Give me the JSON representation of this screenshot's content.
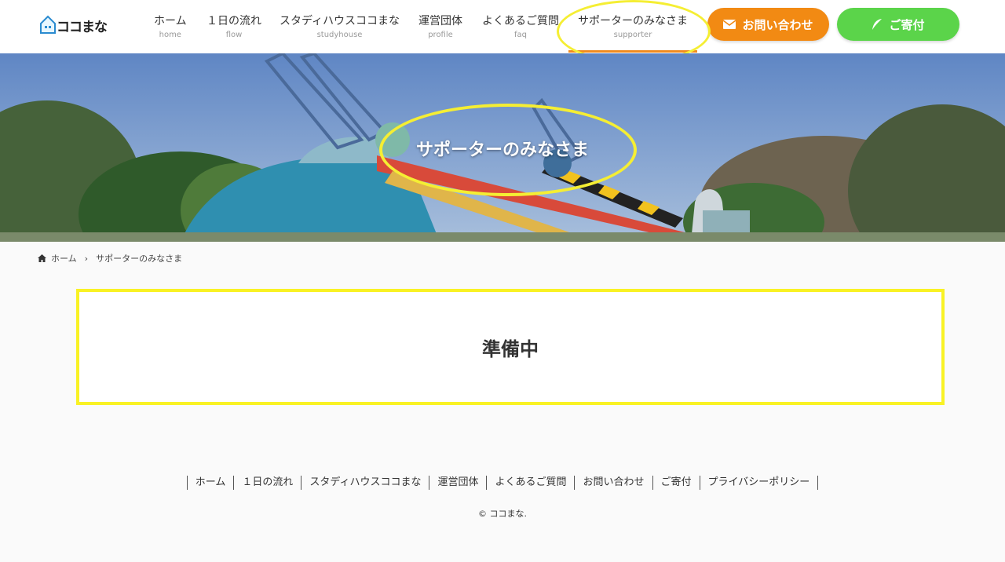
{
  "logo": {
    "text": "ココまな"
  },
  "nav": [
    {
      "label": "ホーム",
      "sub": "home",
      "active": false
    },
    {
      "label": "１日の流れ",
      "sub": "flow",
      "active": false
    },
    {
      "label": "スタディハウスココまな",
      "sub": "studyhouse",
      "active": false
    },
    {
      "label": "運営団体",
      "sub": "profile",
      "active": false
    },
    {
      "label": "よくあるご質問",
      "sub": "faq",
      "active": false
    },
    {
      "label": "サポーターのみなさま",
      "sub": "supporter",
      "active": true
    }
  ],
  "buttons": {
    "contact": {
      "label": "お問い合わせ",
      "icon": "mail-icon",
      "color": "#f28a13"
    },
    "donate": {
      "label": "ご寄付",
      "icon": "feather-icon",
      "color": "#5bd44a"
    }
  },
  "hero": {
    "title": "サポーターのみなさま"
  },
  "breadcrumb": {
    "home": "ホーム",
    "current": "サポーターのみなさま"
  },
  "content": {
    "notice": "準備中"
  },
  "footer": {
    "links": [
      "ホーム",
      "１日の流れ",
      "スタディハウスココまな",
      "運営団体",
      "よくあるご質問",
      "お問い合わせ",
      "ご寄付",
      "プライバシーポリシー"
    ],
    "copyright": "© ココまな."
  },
  "colors": {
    "highlight": "#f5ee33",
    "accent": "#f18b1e"
  }
}
